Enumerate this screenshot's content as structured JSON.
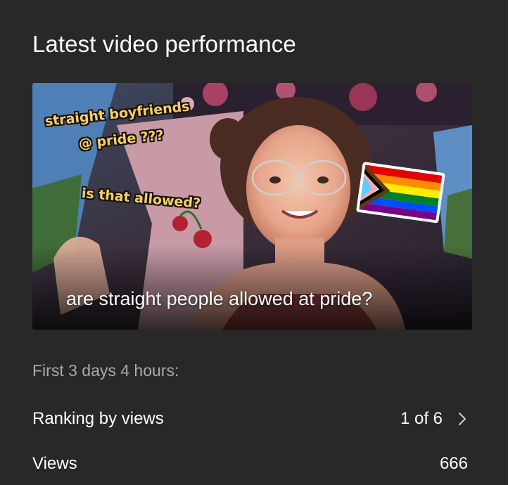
{
  "card": {
    "title": "Latest video performance"
  },
  "video": {
    "title": "are straight people allowed at pride?",
    "thumbnail_text": {
      "line1": "straight boyfriends",
      "line2": "@ pride ???",
      "line3": "is that allowed?"
    }
  },
  "period": {
    "label": "First 3 days 4 hours:"
  },
  "metrics": {
    "ranking": {
      "label": "Ranking by views",
      "value": "1 of 6",
      "icon": "chevron-right-icon"
    },
    "views": {
      "label": "Views",
      "value": "666"
    }
  },
  "colors": {
    "card_bg": "#282828",
    "text_primary": "#ffffff",
    "text_secondary": "#aaaaaa",
    "sticker_text": "#f3d066"
  }
}
